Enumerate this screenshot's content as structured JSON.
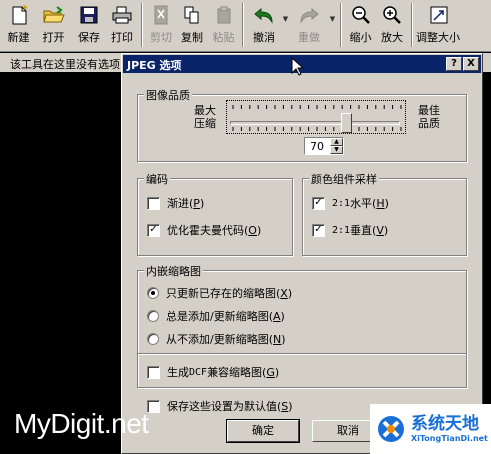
{
  "toolbar": {
    "buttons": [
      {
        "label": "新建",
        "icon": "new-file-icon",
        "enabled": true
      },
      {
        "label": "打开",
        "icon": "open-folder-icon",
        "enabled": true
      },
      {
        "label": "保存",
        "icon": "save-disk-icon",
        "enabled": true
      },
      {
        "label": "打印",
        "icon": "printer-icon",
        "enabled": true
      },
      {
        "label": "剪切",
        "icon": "cut-icon",
        "enabled": false
      },
      {
        "label": "复制",
        "icon": "copy-icon",
        "enabled": true
      },
      {
        "label": "粘贴",
        "icon": "paste-icon",
        "enabled": false
      },
      {
        "label": "撤消",
        "icon": "undo-arrow-icon",
        "enabled": true
      },
      {
        "label": "重做",
        "icon": "redo-arrow-icon",
        "enabled": false
      },
      {
        "label": "缩小",
        "icon": "zoom-out-icon",
        "enabled": true
      },
      {
        "label": "放大",
        "icon": "zoom-in-icon",
        "enabled": true
      },
      {
        "label": "调整大小",
        "icon": "resize-icon",
        "enabled": true
      }
    ]
  },
  "hintbar": {
    "text": "该工具在这里没有选项"
  },
  "dialog": {
    "title": "JPEG 选项",
    "help_label": "?",
    "close_label": "X",
    "quality": {
      "legend": "图像品质",
      "left_label_1": "最大",
      "left_label_2": "压缩",
      "right_label_1": "最佳",
      "right_label_2": "品质",
      "value": "70",
      "slider_level": 0.7
    },
    "encoding": {
      "legend": "编码",
      "options": [
        {
          "label": "渐进(",
          "key": "P",
          "suffix": ")",
          "checked": false
        },
        {
          "label": "优化霍夫曼代码(",
          "key": "O",
          "suffix": ")",
          "checked": true
        }
      ]
    },
    "sampling": {
      "legend": "颜色组件采样",
      "options": [
        {
          "prefix": "2:1",
          "label": " 水平(",
          "key": "H",
          "suffix": ")",
          "checked": true
        },
        {
          "prefix": "2:1",
          "label": " 垂直(",
          "key": "V",
          "suffix": ")",
          "checked": true
        }
      ]
    },
    "thumbnail": {
      "legend": "内嵌缩略图",
      "radios": [
        {
          "label": "只更新已存在的缩略图(",
          "key": "X",
          "suffix": ")",
          "selected": true
        },
        {
          "label": "总是添加/更新缩略图(",
          "key": "A",
          "suffix": ")",
          "selected": false
        },
        {
          "label": "从不添加/更新缩略图(",
          "key": "N",
          "suffix": ")",
          "selected": false
        }
      ],
      "dcf": {
        "label_pre": "生成 ",
        "mono": "DCF",
        "label_post": " 兼容缩略图(",
        "key": "G",
        "suffix": ")",
        "checked": false
      }
    },
    "save_default": {
      "label": "保存这些设置为默认值(",
      "key": "S",
      "suffix": ")",
      "checked": false
    },
    "ok_label": "确定",
    "cancel_label": "取消"
  },
  "watermarks": {
    "left": "MyDigit.net",
    "right_cn": "系统天地",
    "right_en": "XiTongTianDi.net"
  }
}
